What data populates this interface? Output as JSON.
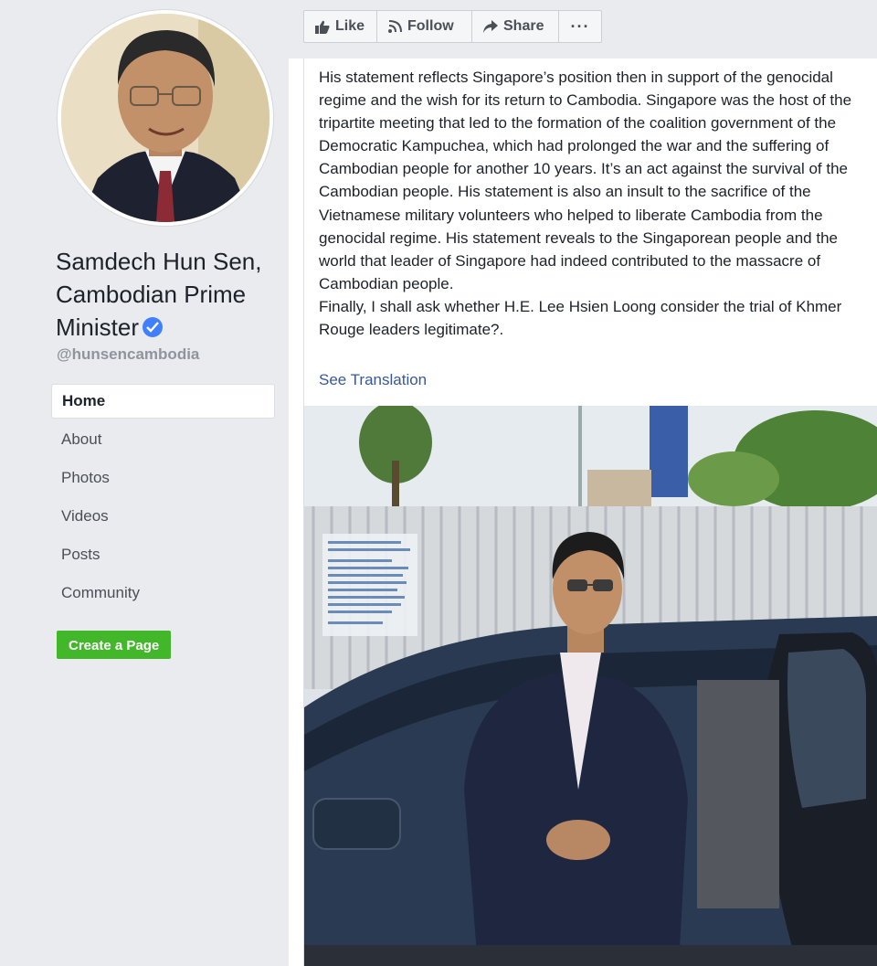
{
  "profile": {
    "name": "Samdech Hun Sen, Cambodian Prime Minister",
    "handle": "@hunsencambodia",
    "verified_icon": "verified-badge-icon"
  },
  "nav": [
    {
      "label": "Home",
      "active": true
    },
    {
      "label": "About",
      "active": false
    },
    {
      "label": "Photos",
      "active": false
    },
    {
      "label": "Videos",
      "active": false
    },
    {
      "label": "Posts",
      "active": false
    },
    {
      "label": "Community",
      "active": false
    }
  ],
  "create_page_label": "Create a Page",
  "actions": {
    "like": "Like",
    "follow": "Follow",
    "share": "Share",
    "more": "···"
  },
  "post": {
    "paragraphs": [
      "His statement reflects Singapore’s position then in support of the genocidal regime and the wish for its return to Cambodia. Singapore was the host of the tripartite meeting that led to the formation of the coalition government of the Democratic Kampuchea, which had prolonged the war and the suffering of Cambodian people for another 10 years. It’s an act against the survival of the Cambodian people. His statement is also an insult to the sacrifice of the Vietnamese military volunteers who helped to liberate Cambodia from the genocidal regime. His statement reveals to the Singaporean people and the world that leader of Singapore had indeed contributed to the massacre of Cambodian people.",
      "Finally, I shall ask whether H.E. Lee Hsien Loong consider the trial of Khmer Rouge leaders legitimate?."
    ],
    "see_translation": "See Translation"
  },
  "colors": {
    "background": "#e9ebee",
    "link": "#385898",
    "create_button": "#42b72a",
    "verified": "#4080ff"
  }
}
